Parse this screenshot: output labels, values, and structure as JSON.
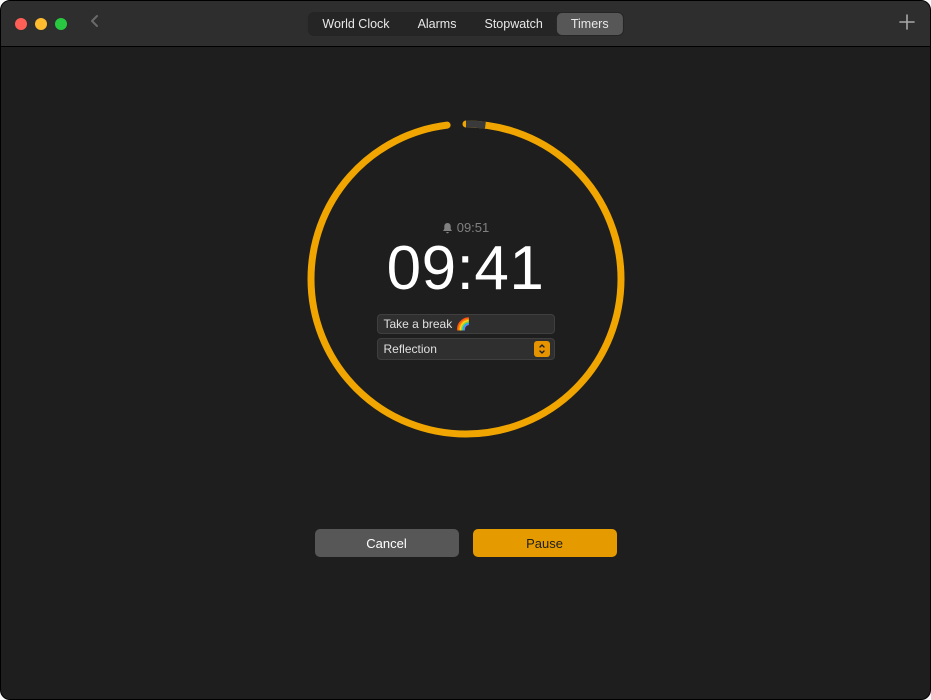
{
  "tabs": {
    "world_clock": "World Clock",
    "alarms": "Alarms",
    "stopwatch": "Stopwatch",
    "timers": "Timers"
  },
  "timer": {
    "ends_at": "09:51",
    "remaining": "09:41",
    "label": "Take a break 🌈",
    "sound": "Reflection",
    "progress_fraction": 0.02
  },
  "buttons": {
    "cancel": "Cancel",
    "pause": "Pause"
  },
  "colors": {
    "accent": "#f0a500"
  }
}
